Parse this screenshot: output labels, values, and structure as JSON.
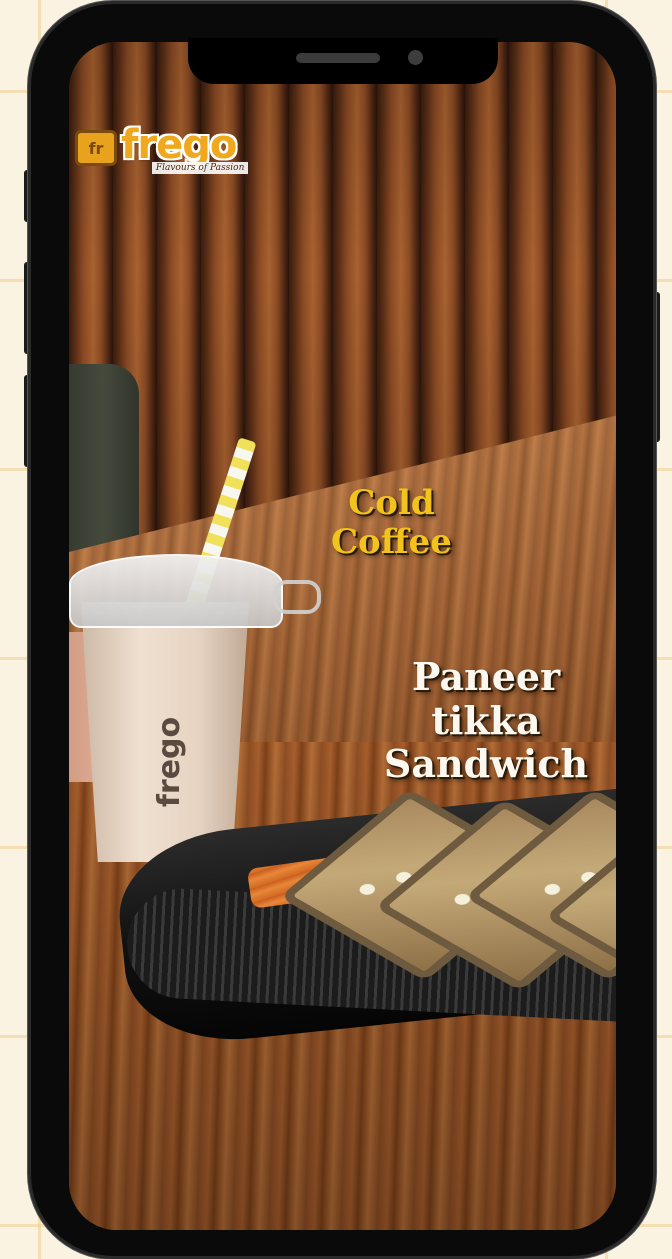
{
  "logo": {
    "mark": "fr",
    "wordmark": "frego",
    "tagline": "Flavours of Passion"
  },
  "captions": {
    "coffee_line1": "Cold",
    "coffee_line2": "Coffee",
    "sandwich_line1": "Paneer tikka",
    "sandwich_line2": "Sandwich"
  },
  "cup_brand": "frego",
  "colors": {
    "background": "#fbf3e2",
    "grid_lines": "#f0cd8c",
    "phone_frame": "#0a0a0a",
    "coffee_caption": "#f2c21d",
    "sandwich_caption": "#fcf7ef",
    "logo_brand": "#f0a91e"
  }
}
